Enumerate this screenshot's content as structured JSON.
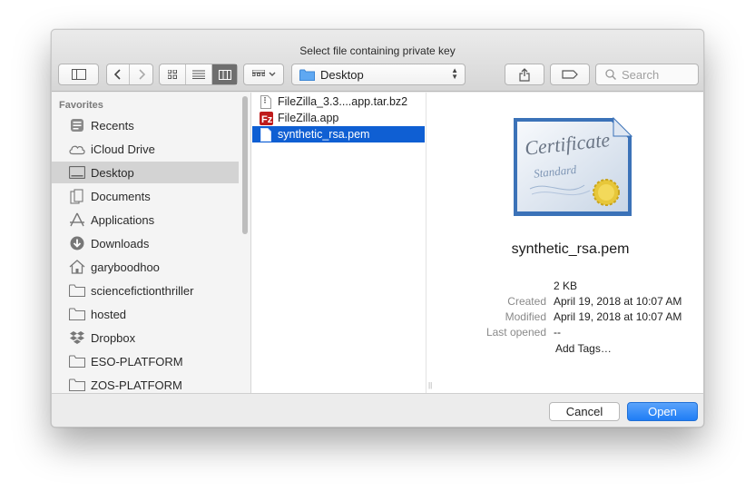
{
  "window": {
    "title": "Select file containing private key"
  },
  "toolbar": {
    "location_label": "Desktop",
    "search_placeholder": "Search"
  },
  "sidebar": {
    "heading": "Favorites",
    "items": [
      {
        "label": "Recents",
        "icon": "clock-icon"
      },
      {
        "label": "iCloud Drive",
        "icon": "cloud-icon"
      },
      {
        "label": "Desktop",
        "icon": "desktop-icon",
        "selected": true
      },
      {
        "label": "Documents",
        "icon": "document-icon"
      },
      {
        "label": "Applications",
        "icon": "applications-icon"
      },
      {
        "label": "Downloads",
        "icon": "download-icon"
      },
      {
        "label": "garyboodhoo",
        "icon": "home-icon"
      },
      {
        "label": "sciencefictionthriller",
        "icon": "folder-icon"
      },
      {
        "label": "hosted",
        "icon": "folder-icon"
      },
      {
        "label": "Dropbox",
        "icon": "dropbox-icon"
      },
      {
        "label": "ESO-PLATFORM",
        "icon": "folder-icon"
      },
      {
        "label": "ZOS-PLATFORM",
        "icon": "folder-icon"
      }
    ]
  },
  "files": [
    {
      "label": "FileZilla_3.3....app.tar.bz2",
      "icon": "archive-file-icon"
    },
    {
      "label": "FileZilla.app",
      "icon": "filezilla-app-icon"
    },
    {
      "label": "synthetic_rsa.pem",
      "icon": "pem-file-icon",
      "selected": true
    }
  ],
  "preview": {
    "certificate_text_1": "Certificate",
    "certificate_text_2": "Standard",
    "name": "synthetic_rsa.pem",
    "size": "2 KB",
    "created_label": "Created",
    "created_value": "April 19, 2018 at 10:07 AM",
    "modified_label": "Modified",
    "modified_value": "April 19, 2018 at 10:07 AM",
    "last_opened_label": "Last opened",
    "last_opened_value": "--",
    "add_tags": "Add Tags…"
  },
  "buttons": {
    "cancel": "Cancel",
    "open": "Open"
  },
  "colors": {
    "selection": "#0f5fd3",
    "accent": "#1f7df5",
    "link": "#1a6fe0"
  }
}
